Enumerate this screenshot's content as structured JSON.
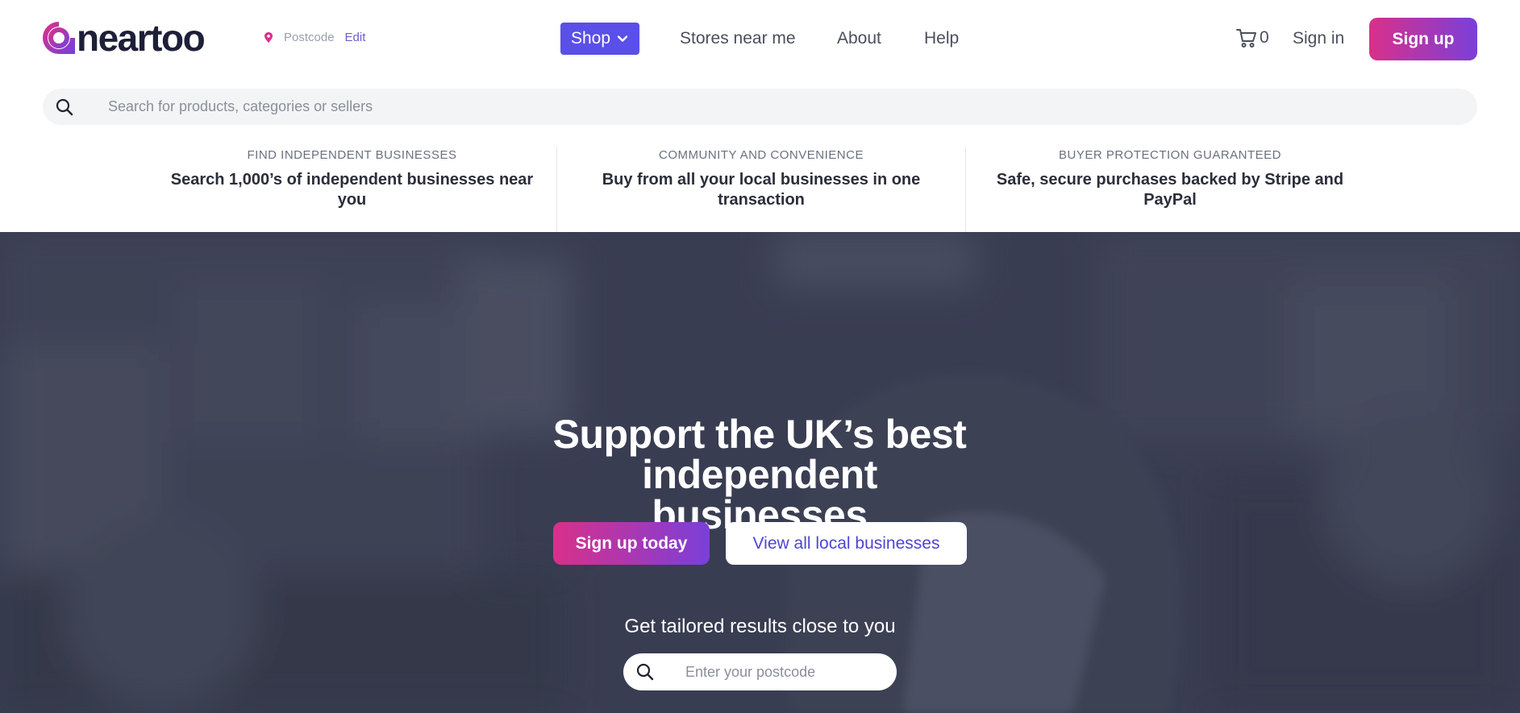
{
  "brand": {
    "name": "neartoo",
    "gradient_start": "#d9308a",
    "gradient_end": "#7b3fd9"
  },
  "location": {
    "postcode_label": "Postcode",
    "edit_label": "Edit"
  },
  "nav": {
    "shop_label": "Shop",
    "stores_label": "Stores near me",
    "about_label": "About",
    "help_label": "Help"
  },
  "account": {
    "cart_count": "0",
    "signin_label": "Sign in",
    "signup_label": "Sign up"
  },
  "search": {
    "placeholder": "Search for products, categories or sellers"
  },
  "features": [
    {
      "label": "FIND INDEPENDENT BUSINESSES",
      "text": "Search 1,000’s of independent businesses near you"
    },
    {
      "label": "COMMUNITY AND CONVENIENCE",
      "text": "Buy from all your local businesses in one transaction"
    },
    {
      "label": "BUYER PROTECTION GUARANTEED",
      "text": "Safe, secure purchases backed by Stripe and PayPal"
    }
  ],
  "hero": {
    "title": "Support the UK’s best independent businesses",
    "signup_button": "Sign up today",
    "view_button": "View all local businesses",
    "subtitle": "Get tailored results close to you",
    "postcode_placeholder": "Enter your postcode"
  },
  "colors": {
    "shop_button": "#5a4fe8",
    "link_accent": "#4f44d6",
    "hero_overlay": "#3e4253"
  },
  "icons": [
    "location-pin-icon",
    "chevron-down-icon",
    "cart-icon",
    "search-icon"
  ]
}
